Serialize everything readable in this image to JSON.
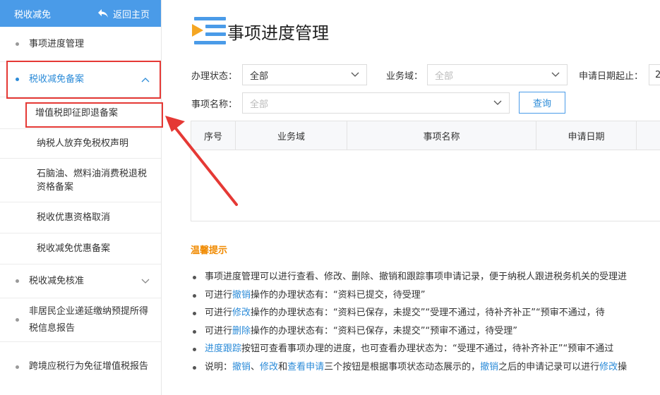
{
  "sidebar": {
    "title": "税收减免",
    "back_label": "返回主页",
    "items": [
      {
        "label": "事项进度管理"
      },
      {
        "label": "税收减免备案"
      },
      {
        "label": "税收减免核准"
      },
      {
        "label": "非居民企业递延缴纳预提所得税信息报告"
      },
      {
        "label": "跨境应税行为免征增值税报告"
      }
    ],
    "subitems": [
      {
        "label": "增值税即征即退备案"
      },
      {
        "label": "纳税人放弃免税权声明"
      },
      {
        "label": "石脑油、燃料油消费税退税资格备案"
      },
      {
        "label": "税收优惠资格取消"
      },
      {
        "label": "税收减免优惠备案"
      }
    ]
  },
  "main": {
    "title": "事项进度管理",
    "filters": {
      "status_label": "办理状态：",
      "status_value": "全部",
      "domain_label": "业务域：",
      "domain_placeholder": "全部",
      "date_label": "申请日期起止：",
      "date_value": "2",
      "name_label": "事项名称：",
      "name_placeholder": "全部",
      "query_label": "查询"
    },
    "table": {
      "columns": [
        "序号",
        "业务域",
        "事项名称",
        "申请日期",
        ""
      ]
    },
    "tips": {
      "title": "温馨提示",
      "lines": [
        {
          "parts": [
            {
              "t": "事项进度管理可以进行查看、修改、删除、撤销和跟踪事项申请记录，便于纳税人跟进税务机关的受理进"
            }
          ]
        },
        {
          "parts": [
            {
              "t": "可进行"
            },
            {
              "t": "撤销",
              "link": true
            },
            {
              "t": "操作的办理状态有：“资料已提交，待受理”"
            }
          ]
        },
        {
          "parts": [
            {
              "t": "可进行"
            },
            {
              "t": "修改",
              "link": true
            },
            {
              "t": "操作的办理状态有：“资料已保存，未提交”“受理不通过，待补齐补正”“预审不通过，待"
            }
          ]
        },
        {
          "parts": [
            {
              "t": "可进行"
            },
            {
              "t": "删除",
              "link": true
            },
            {
              "t": "操作的办理状态有：“资料已保存，未提交”“预审不通过，待受理”"
            }
          ]
        },
        {
          "parts": [
            {
              "t": "进度跟踪",
              "link": true
            },
            {
              "t": "按钮可查看事项办理的进度，也可查看办理状态为：“受理不通过，待补齐补正”“预审不通过"
            }
          ]
        },
        {
          "parts": [
            {
              "t": "说明："
            },
            {
              "t": "撤销",
              "link": true
            },
            {
              "t": "、"
            },
            {
              "t": "修改",
              "link": true
            },
            {
              "t": "和"
            },
            {
              "t": "查看申请",
              "link": true
            },
            {
              "t": "三个按钮是根据事项状态动态展示的，"
            },
            {
              "t": "撤销",
              "link": true
            },
            {
              "t": "之后的申请记录可以进行"
            },
            {
              "t": "修改",
              "link": true
            },
            {
              "t": "操"
            }
          ]
        }
      ]
    }
  },
  "colors": {
    "accent": "#4a9be8",
    "link": "#2b8bd8",
    "highlight_border": "#e53935",
    "tips_title": "#f08a00",
    "icon_orange": "#f5a623"
  }
}
